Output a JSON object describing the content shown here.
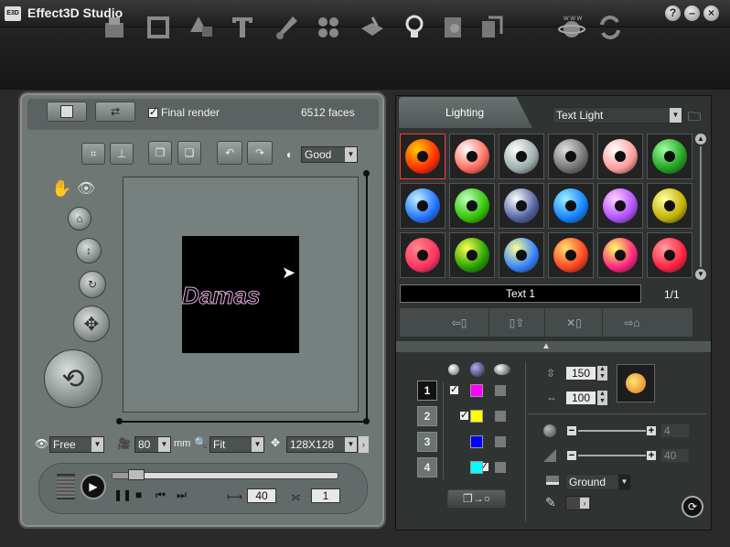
{
  "app": {
    "logo": "E3D",
    "title": "Effect3D Studio"
  },
  "window_controls": {
    "help": "?",
    "minimize": "–",
    "close": "×"
  },
  "toolbar": {
    "tools": [
      "model-icon",
      "frame-icon",
      "shape-icon",
      "text-tool-icon",
      "material-icon",
      "pattern-icon",
      "background-icon",
      "light-bulb-icon",
      "texture-icon",
      "export-icon",
      "web-icon",
      "refresh-icon"
    ]
  },
  "left": {
    "final_render_label": "Final render",
    "final_render_checked": true,
    "faces": "6512 faces",
    "quality": "Good",
    "preview_text": "Damas",
    "mode": "Free",
    "camera_distance": "80",
    "distance_unit": "mm",
    "zoom": "Fit",
    "size": "128X128",
    "frame_length": "40",
    "current_frame": "1",
    "playback_position": 0.08
  },
  "right": {
    "tab": "Lighting",
    "preset_combo": "Text Light",
    "selected_name": "Text 1",
    "page": "1/1",
    "swatches": [
      [
        "#ffcc00",
        "#ff2a00"
      ],
      [
        "#ffffff",
        "#ff6a5a"
      ],
      [
        "#ffffff",
        "#9aa"
      ],
      [
        "#e0e0e0",
        "#707070"
      ],
      [
        "#ffffff",
        "#ff9a9a"
      ],
      [
        "#9fff9f",
        "#20a020"
      ],
      [
        "#c0f0ff",
        "#2070ff"
      ],
      [
        "#bfffbf",
        "#30c000"
      ],
      [
        "#ffffff",
        "#5060a0"
      ],
      [
        "#9fefff",
        "#1080ff"
      ],
      [
        "#ffd0ff",
        "#b050ff"
      ],
      [
        "#ffffa0",
        "#c0b000"
      ],
      [
        "#ff8a8a",
        "#ff3060"
      ],
      [
        "#ffff50",
        "#20a000"
      ],
      [
        "#ffff90",
        "#3080ff"
      ],
      [
        "#ffe070",
        "#ff4020"
      ],
      [
        "#ffff60",
        "#ff2080"
      ],
      [
        "#ffa0a0",
        "#ff2040"
      ]
    ],
    "layers": [
      {
        "label": "1",
        "enabled": true,
        "color": "#ff00ff"
      },
      {
        "label": "2",
        "enabled": true,
        "color": "#ffff00"
      },
      {
        "label": "3",
        "enabled": true,
        "color": "#0000ff"
      },
      {
        "label": "4",
        "enabled": true,
        "color": "#00ffff"
      }
    ],
    "vertical_value": "150",
    "horizontal_value": "100",
    "slider1_value": "4",
    "slider2_value": "40",
    "ground": "Ground"
  }
}
